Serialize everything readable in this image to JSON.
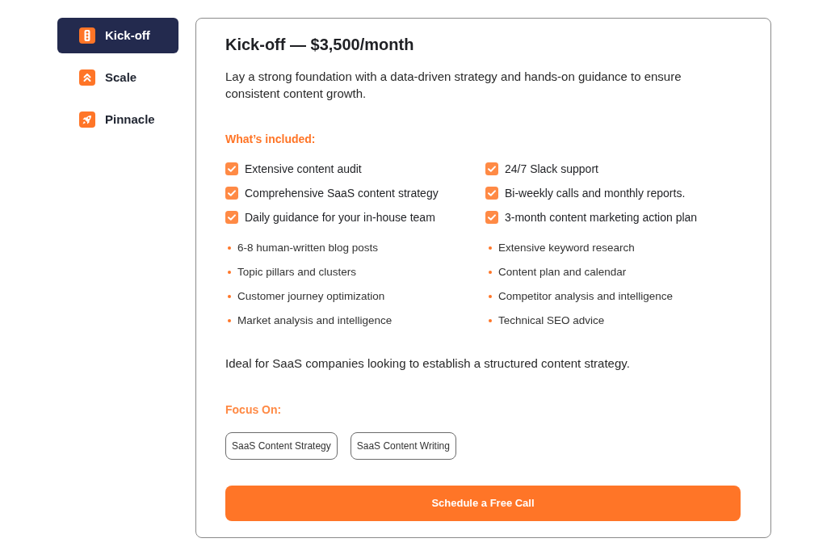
{
  "plans": [
    {
      "label": "Kick-off",
      "selected": true
    },
    {
      "label": "Scale",
      "selected": false
    },
    {
      "label": "Pinnacle",
      "selected": false
    }
  ],
  "plan": {
    "title": "Kick-off — $3,500/month",
    "description": "Lay a strong foundation with a data-driven strategy and hands-on guidance to ensure consistent content growth.",
    "included_heading": "What’s included:",
    "checklist": [
      {
        "text": "Extensive content audit",
        "checked": true
      },
      {
        "text": "24/7 Slack support",
        "checked": true
      },
      {
        "text": "Comprehensive SaaS content strategy",
        "checked": true
      },
      {
        "text": "Bi-weekly calls and monthly reports.",
        "checked": true
      },
      {
        "text": "Daily guidance for your in-house team",
        "checked": true
      },
      {
        "text": "3-month content marketing action plan",
        "checked": true
      }
    ],
    "bullets": [
      "6-8 human-written blog posts",
      "Extensive keyword research",
      "Topic pillars and clusters",
      "Content plan and calendar",
      "Customer journey optimization",
      "Competitor analysis and intelligence",
      "Market analysis and intelligence",
      "Technical SEO advice"
    ],
    "ideal_for": "Ideal for SaaS companies looking to establish a structured content strategy.",
    "focus_heading": "Focus On:",
    "focus_tags": [
      "SaaS Content Strategy",
      "SaaS Content Writing"
    ],
    "cta": "Schedule a Free Call"
  }
}
